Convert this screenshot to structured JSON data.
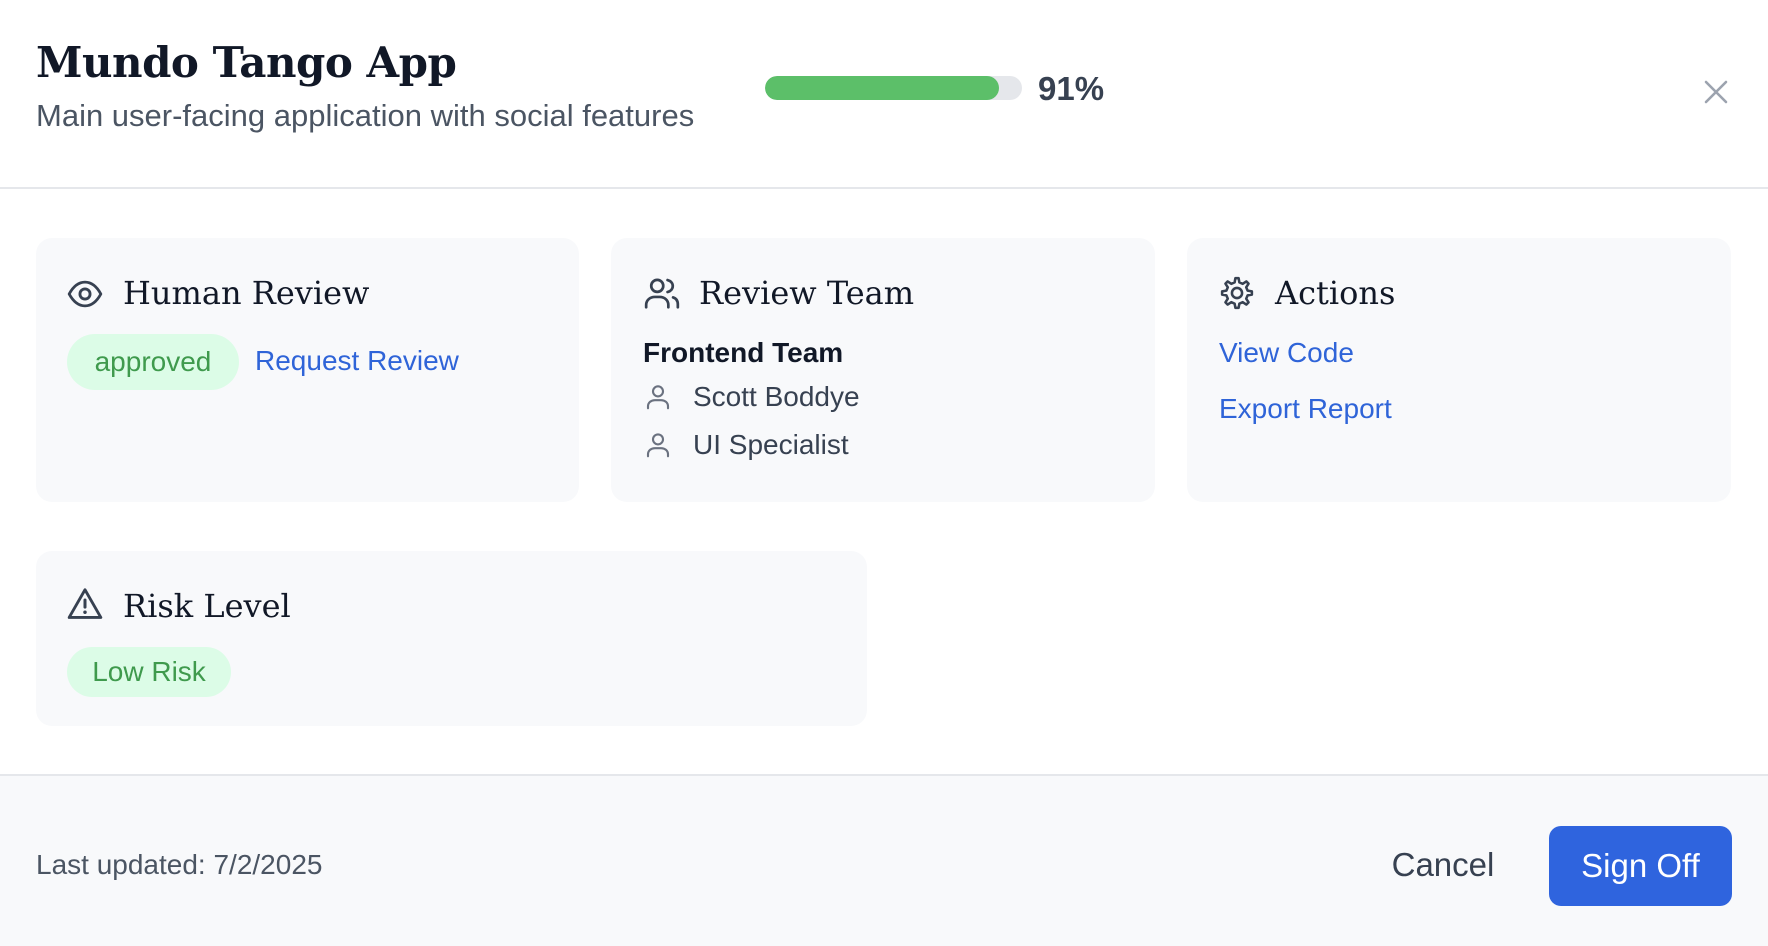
{
  "header": {
    "title": "Mundo Tango App",
    "subtitle": "Main user-facing application with social features",
    "progress_percent": 91,
    "progress_label": "91%",
    "close_icon": "close-icon"
  },
  "cards": {
    "human_review": {
      "icon": "eye-icon",
      "title": "Human Review",
      "status_badge": "approved",
      "request_link": "Request Review"
    },
    "review_team": {
      "icon": "users-icon",
      "title": "Review Team",
      "team_name": "Frontend Team",
      "members": [
        {
          "icon": "user-icon",
          "name": "Scott Boddye"
        },
        {
          "icon": "user-icon",
          "name": "UI Specialist"
        }
      ]
    },
    "actions": {
      "icon": "gear-icon",
      "title": "Actions",
      "links": [
        "View Code",
        "Export Report"
      ]
    },
    "risk_level": {
      "icon": "warning-triangle-icon",
      "title": "Risk Level",
      "badge": "Low Risk"
    }
  },
  "footer": {
    "last_updated": "Last updated: 7/2/2025",
    "cancel_label": "Cancel",
    "signoff_label": "Sign Off"
  },
  "colors": {
    "accent": "#2f64de",
    "progress": "#5cbf69",
    "success_bg": "#dcfce7",
    "success_text": "#3f9a4d",
    "link": "#2f64d8"
  }
}
